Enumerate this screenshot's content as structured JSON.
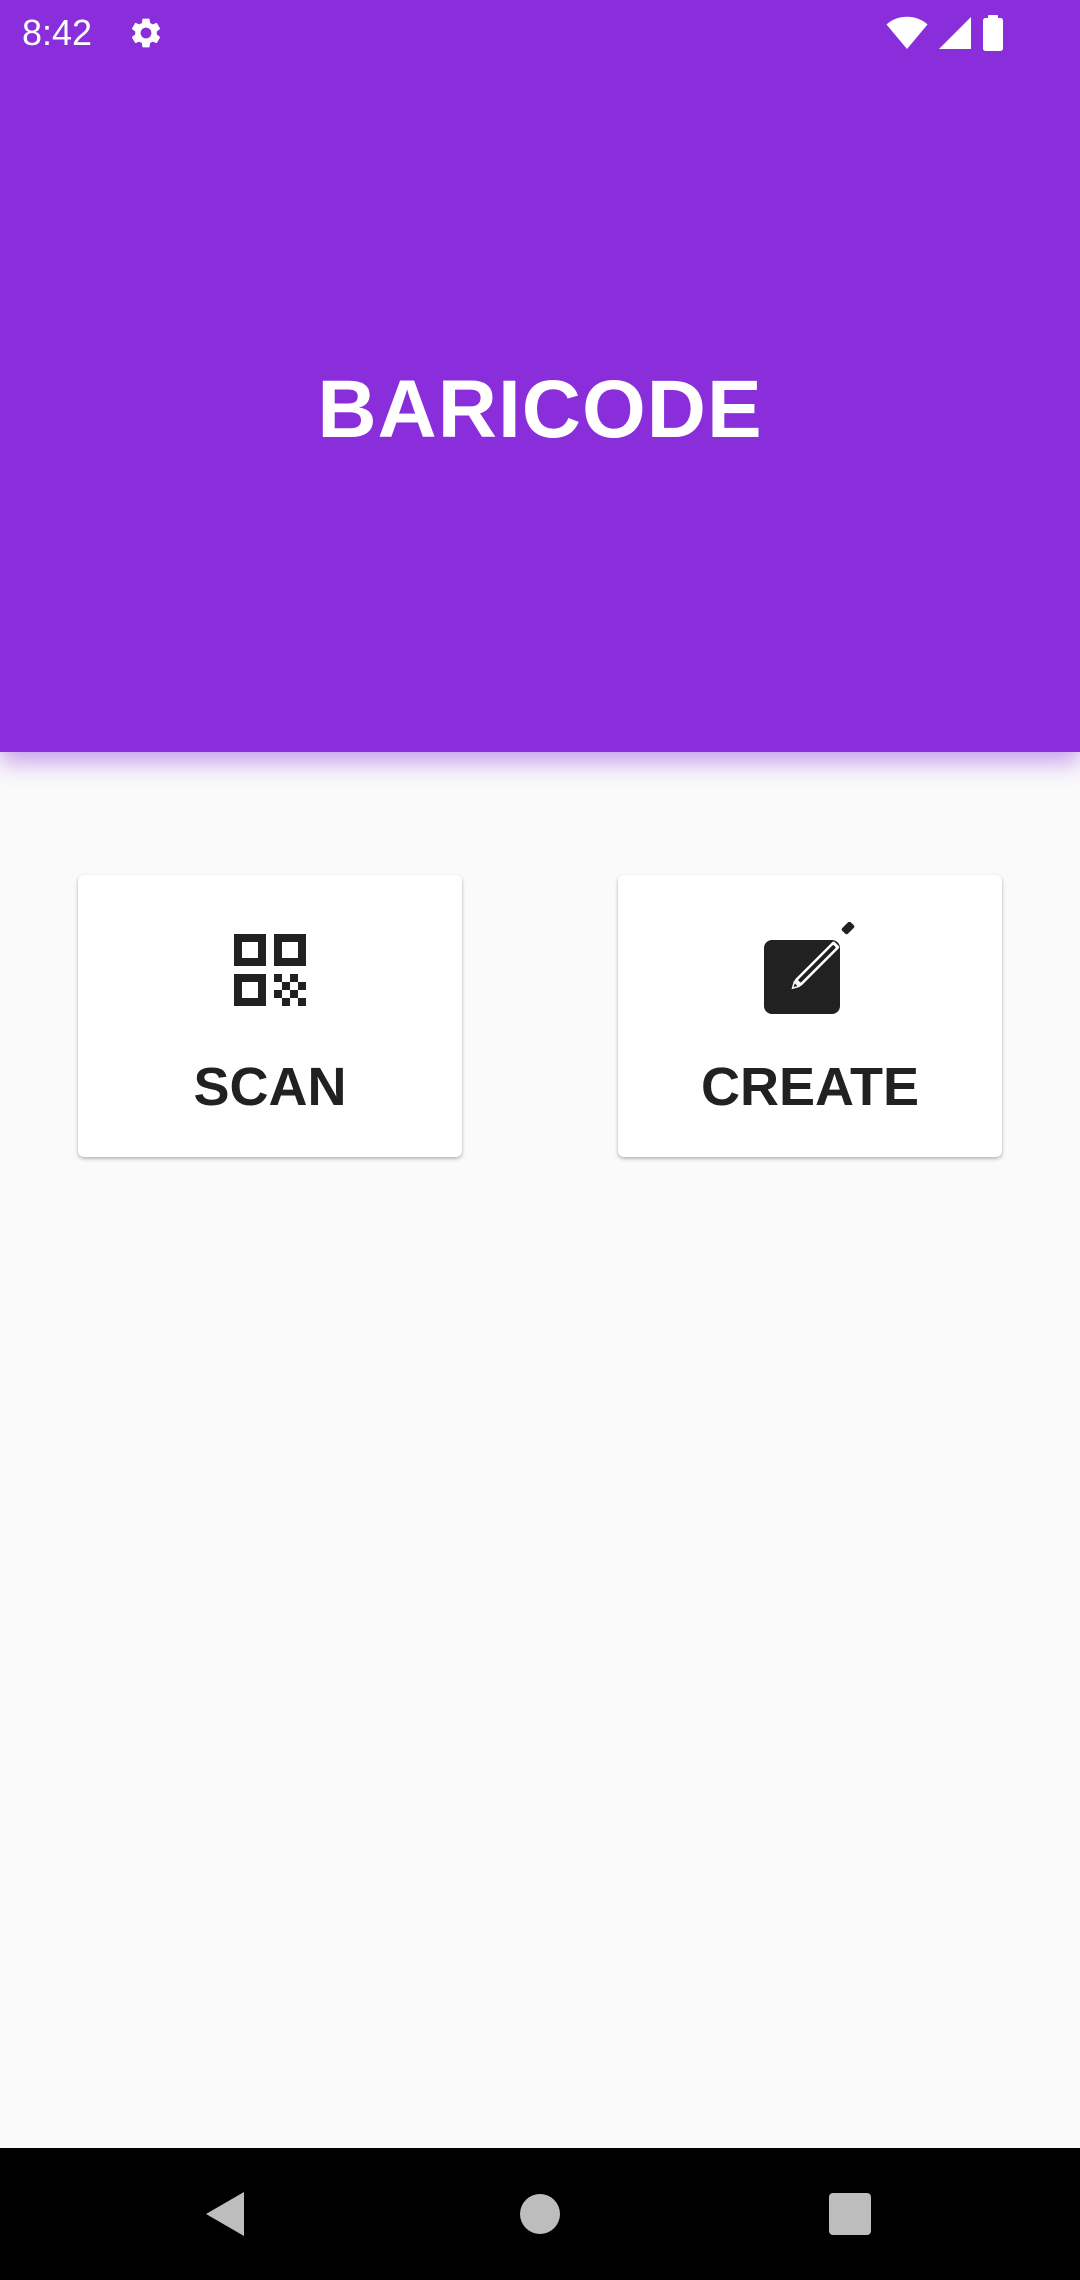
{
  "status_bar": {
    "time": "8:42",
    "icons": [
      "settings-gear-icon",
      "wifi-icon",
      "cell-signal-icon",
      "battery-icon"
    ]
  },
  "header": {
    "title": "BARICODE",
    "background_color": "#8A2EDC"
  },
  "cards": {
    "scan": {
      "label": "SCAN",
      "icon": "qr-code-icon"
    },
    "create": {
      "label": "CREATE",
      "icon": "edit-square-icon"
    }
  },
  "navigation_bar": {
    "buttons": [
      "back-icon",
      "home-icon",
      "recents-icon"
    ]
  },
  "colors": {
    "accent": "#8A2EDC",
    "background": "#FAFAFA",
    "card": "#FFFFFF",
    "text_dark": "#212121"
  }
}
